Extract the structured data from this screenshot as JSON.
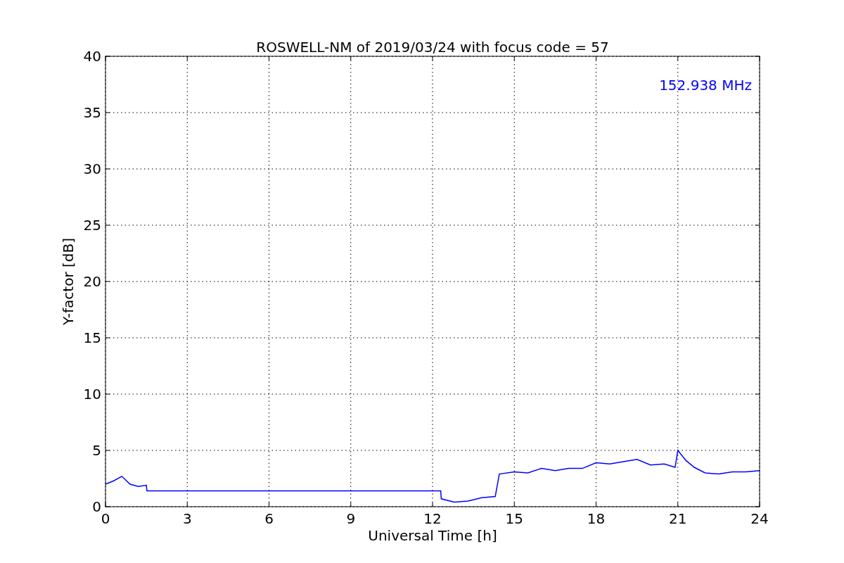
{
  "chart_data": {
    "type": "line",
    "title": "ROSWELL-NM of 2019/03/24 with focus code = 57",
    "xlabel": "Universal Time [h]",
    "ylabel": "Y-factor [dB]",
    "x": [
      0,
      0.3,
      0.6,
      0.9,
      1.2,
      1.5,
      1.52,
      12.3,
      12.32,
      12.8,
      13.3,
      13.8,
      14.3,
      14.45,
      15,
      15.5,
      16,
      16.5,
      17,
      17.5,
      18,
      18.5,
      19,
      19.5,
      20,
      20.5,
      20.9,
      21.0,
      21.3,
      21.6,
      22,
      22.5,
      23,
      23.5,
      24
    ],
    "series": [
      {
        "color": "#0000ff",
        "values": [
          2.0,
          2.3,
          2.7,
          2.0,
          1.8,
          1.9,
          1.4,
          1.4,
          0.7,
          0.4,
          0.5,
          0.8,
          0.9,
          2.9,
          3.1,
          3.0,
          3.4,
          3.2,
          3.4,
          3.4,
          3.9,
          3.8,
          4.0,
          4.2,
          3.7,
          3.8,
          3.5,
          5.0,
          4.1,
          3.5,
          3.0,
          2.9,
          3.1,
          3.1,
          3.2
        ]
      }
    ],
    "xlim": [
      0,
      24
    ],
    "ylim": [
      0,
      40
    ],
    "xticks": [
      0,
      3,
      6,
      9,
      12,
      15,
      18,
      21,
      24
    ],
    "yticks": [
      0,
      5,
      10,
      15,
      20,
      25,
      30,
      35,
      40
    ],
    "grid": true,
    "annotations": [
      "152.938 MHz"
    ]
  }
}
